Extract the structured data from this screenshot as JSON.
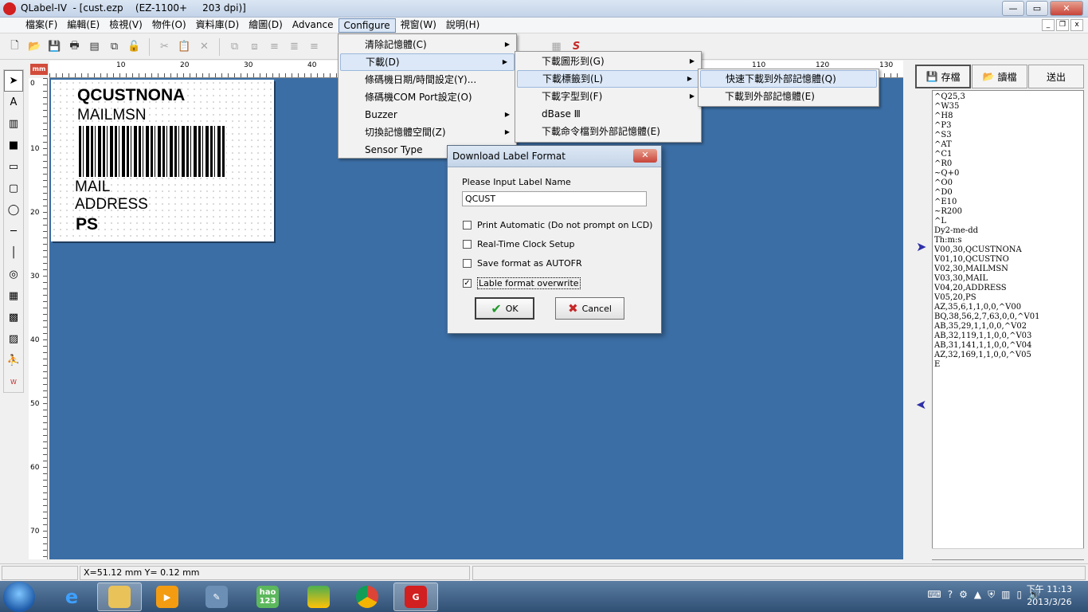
{
  "window": {
    "title": "QLabel-IV  - [cust.ezp    (EZ-1100+     203 dpi)]",
    "min": "—",
    "max": "▭",
    "close": "✕"
  },
  "menubar": {
    "items": [
      "檔案(F)",
      "編輯(E)",
      "檢視(V)",
      "物件(O)",
      "資料庫(D)",
      "繪圖(D)",
      "Advance",
      "Configure",
      "視窗(W)",
      "說明(H)"
    ]
  },
  "mdi": {
    "min": "_",
    "restore": "❐",
    "close": "x"
  },
  "ruler": {
    "unit": "mm",
    "h_ticks": [
      "10",
      "20",
      "30",
      "40",
      "110",
      "120",
      "130"
    ],
    "v_ticks": [
      "0",
      "10",
      "20",
      "30",
      "40",
      "50",
      "60",
      "70"
    ]
  },
  "label": {
    "line1": "QCUSTNONA",
    "line2": "MAILMSN",
    "line3": "MAIL",
    "line4": "ADDRESS",
    "line5": "PS"
  },
  "configure_menu": {
    "items": [
      "清除記憶體(C)",
      "下載(D)",
      "條碼機日期/時間設定(Y)...",
      "條碼機COM Port設定(O)",
      "Buzzer",
      "切換記憶體空間(Z)",
      "Sensor Type"
    ]
  },
  "download_menu": {
    "items": [
      "下載圖形到(G)",
      "下載標籤到(L)",
      "下載字型到(F)",
      "dBase Ⅲ",
      "下載命令檔到外部記憶體(E)"
    ]
  },
  "label_menu": {
    "items": [
      "快速下載到外部記憶體(Q)",
      "下載到外部記憶體(E)"
    ]
  },
  "dialog": {
    "title": "Download Label Format",
    "prompt": "Please Input Label Name",
    "name_value": "QCUST",
    "options": [
      {
        "label": "Print Automatic (Do not prompt on LCD)",
        "checked": false
      },
      {
        "label": "Real-Time Clock Setup",
        "checked": false
      },
      {
        "label": "Save format as AUTOFR",
        "checked": false
      },
      {
        "label": "Lable format overwrite",
        "checked": true
      }
    ],
    "ok": "OK",
    "cancel": "Cancel"
  },
  "right_panel": {
    "save": "存檔",
    "read": "讀檔",
    "send": "送出",
    "code": [
      "^Q25,3",
      "^W35",
      "^H8",
      "^P3",
      "^S3",
      "^AT",
      "^C1",
      "^R0",
      "~Q+0",
      "^O0",
      "^D0",
      "^E10",
      "~R200",
      "^L",
      "Dy2-me-dd",
      "Th:m:s",
      "V00,30,QCUSTNONA",
      "V01,10,QCUSTNO",
      "V02,30,MAILMSN",
      "V03,30,MAIL",
      "V04,20,ADDRESS",
      "V05,20,PS",
      "AZ,35,6,1,1,0,0,^V00",
      "BQ,38,56,2,7,63,0,0,^V01",
      "AB,35,29,1,1,0,0,^V02",
      "AB,32,119,1,1,0,0,^V03",
      "AB,31,141,1,1,0,0,^V04",
      "AZ,32,169,1,1,0,0,^V05",
      "E"
    ]
  },
  "status": {
    "coords": "X=51.12 mm  Y= 0.12 mm"
  },
  "taskbar": {
    "hao": "hao",
    "hao_num": "123",
    "time": "下午 11:13",
    "date": "2013/3/26"
  },
  "colors": {
    "canvas": "#3b6ea5",
    "menu_highlight": "#dce8f7",
    "close_red": "#c7443a"
  }
}
